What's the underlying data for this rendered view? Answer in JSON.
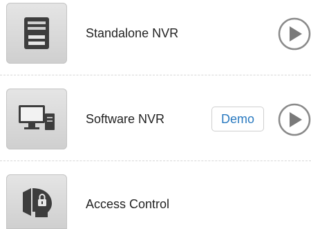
{
  "items": [
    {
      "label": "Standalone NVR",
      "icon": "standalone-nvr-icon",
      "has_play": true
    },
    {
      "label": "Software NVR",
      "icon": "software-nvr-icon",
      "demo_label": "Demo",
      "has_play": true
    },
    {
      "label": "Access Control",
      "icon": "access-control-icon",
      "has_play": false
    }
  ],
  "colors": {
    "demo_text": "#2a7ac0",
    "tile_bg": "#d9d9d9",
    "icon_dark": "#3d3d3d",
    "play_gray": "#7a7a7a"
  }
}
